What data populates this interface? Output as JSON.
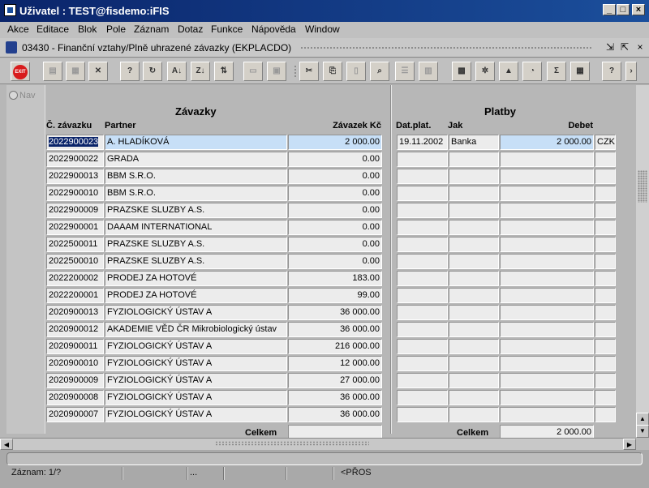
{
  "window": {
    "title": "Uživatel : TEST@fisdemo:iFIS",
    "minimize": "_",
    "maximize": "□",
    "close": "×"
  },
  "menu": [
    "Akce",
    "Editace",
    "Blok",
    "Pole",
    "Záznam",
    "Dotaz",
    "Funkce",
    "Nápověda",
    "Window"
  ],
  "form": {
    "title": "03430 - Finanční vztahy/Plně uhrazené závazky (EKPLACDO)"
  },
  "toolbar": {
    "exit_label": "EXIT"
  },
  "nav": {
    "label": "Nav"
  },
  "zavazky": {
    "title": "Závazky",
    "col_number": "Č. závazku",
    "col_partner": "Partner",
    "col_amount": "Závazek Kč",
    "total_label": "Celkem",
    "total_value": "",
    "rows": [
      {
        "number": "2022900023",
        "partner": "A. HLADÍKOVÁ",
        "amount": "2 000.00"
      },
      {
        "number": "2022900022",
        "partner": "GRADA",
        "amount": "0.00"
      },
      {
        "number": "2022900013",
        "partner": "BBM S.R.O.",
        "amount": "0.00"
      },
      {
        "number": "2022900010",
        "partner": "BBM S.R.O.",
        "amount": "0.00"
      },
      {
        "number": "2022900009",
        "partner": "PRAZSKE SLUZBY A.S.",
        "amount": "0.00"
      },
      {
        "number": "2022900001",
        "partner": "DAAAM INTERNATIONAL",
        "amount": "0.00"
      },
      {
        "number": "2022500011",
        "partner": "PRAZSKE SLUZBY A.S.",
        "amount": "0.00"
      },
      {
        "number": "2022500010",
        "partner": "PRAZSKE SLUZBY A.S.",
        "amount": "0.00"
      },
      {
        "number": "2022200002",
        "partner": "PRODEJ ZA HOTOVÉ",
        "amount": "183.00"
      },
      {
        "number": "2022200001",
        "partner": "PRODEJ ZA HOTOVÉ",
        "amount": "99.00"
      },
      {
        "number": "2020900013",
        "partner": "FYZIOLOGICKÝ ÚSTAV A",
        "amount": "36 000.00"
      },
      {
        "number": "2020900012",
        "partner": "AKADEMIE VĚD ČR Mikrobiologický ústav",
        "amount": "36 000.00"
      },
      {
        "number": "2020900011",
        "partner": "FYZIOLOGICKÝ ÚSTAV A",
        "amount": "216 000.00"
      },
      {
        "number": "2020900010",
        "partner": "FYZIOLOGICKÝ ÚSTAV A",
        "amount": "12 000.00"
      },
      {
        "number": "2020900009",
        "partner": "FYZIOLOGICKÝ ÚSTAV A",
        "amount": "27 000.00"
      },
      {
        "number": "2020900008",
        "partner": "FYZIOLOGICKÝ ÚSTAV A",
        "amount": "36 000.00"
      },
      {
        "number": "2020900007",
        "partner": "FYZIOLOGICKÝ ÚSTAV A",
        "amount": "36 000.00"
      }
    ]
  },
  "platby": {
    "title": "Platby",
    "col_date": "Dat.plat.",
    "col_how": "Jak",
    "col_debet": "Debet",
    "total_label": "Celkem",
    "total_value": "2 000.00",
    "rows": [
      {
        "date": "19.11.2002",
        "how": "Banka",
        "debet": "2 000.00",
        "currency": "CZK"
      }
    ]
  },
  "status": {
    "record": "Záznam: 1/?",
    "ellipsis": "...",
    "mode": "<PŘOS"
  }
}
